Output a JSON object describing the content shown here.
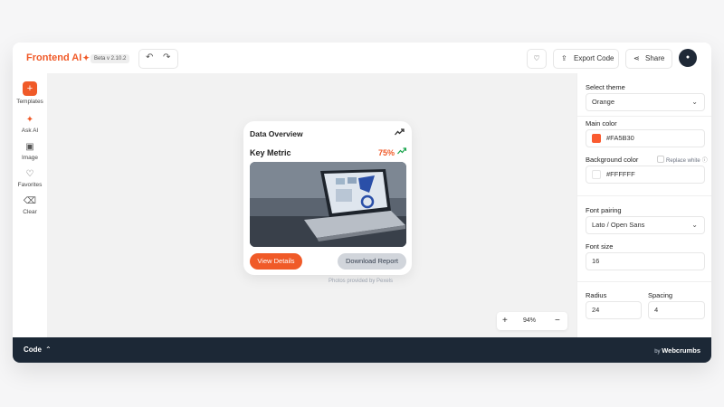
{
  "header": {
    "logo": "Frontend AI",
    "version_badge": "Beta v 2.10.2",
    "export_label": "Export Code",
    "share_label": "Share"
  },
  "sidebar": {
    "items": [
      {
        "label": "Templates",
        "icon": "plus-icon"
      },
      {
        "label": "Ask AI",
        "icon": "sparkle-icon"
      },
      {
        "label": "Image",
        "icon": "image-icon"
      },
      {
        "label": "Favorites",
        "icon": "heart-icon"
      },
      {
        "label": "Clear",
        "icon": "trash-icon"
      }
    ]
  },
  "card": {
    "title": "Data Overview",
    "metric_label": "Key Metric",
    "metric_value": "75%",
    "primary_button": "View Details",
    "secondary_button": "Download Report"
  },
  "canvas": {
    "photo_credit": "Photos provided by Pexels",
    "zoom_level": "94%"
  },
  "panel": {
    "theme_label": "Select theme",
    "theme_value": "Orange",
    "main_color_label": "Main color",
    "main_color_value": "#FA5B30",
    "background_label": "Background color",
    "replace_white_label": "Replace white",
    "background_value": "#FFFFFF",
    "font_pairing_label": "Font pairing",
    "font_pairing_value": "Lato / Open Sans",
    "font_size_label": "Font size",
    "font_size_value": "16",
    "radius_label": "Radius",
    "radius_value": "24",
    "spacing_label": "Spacing",
    "spacing_value": "4"
  },
  "bottom": {
    "code_label": "Code",
    "brand_by": "by",
    "brand_name": "Webcrumbs"
  },
  "colors": {
    "accent": "#F05A28",
    "bottom_bar": "#1C2836",
    "metric_trend": "#16A34A"
  }
}
